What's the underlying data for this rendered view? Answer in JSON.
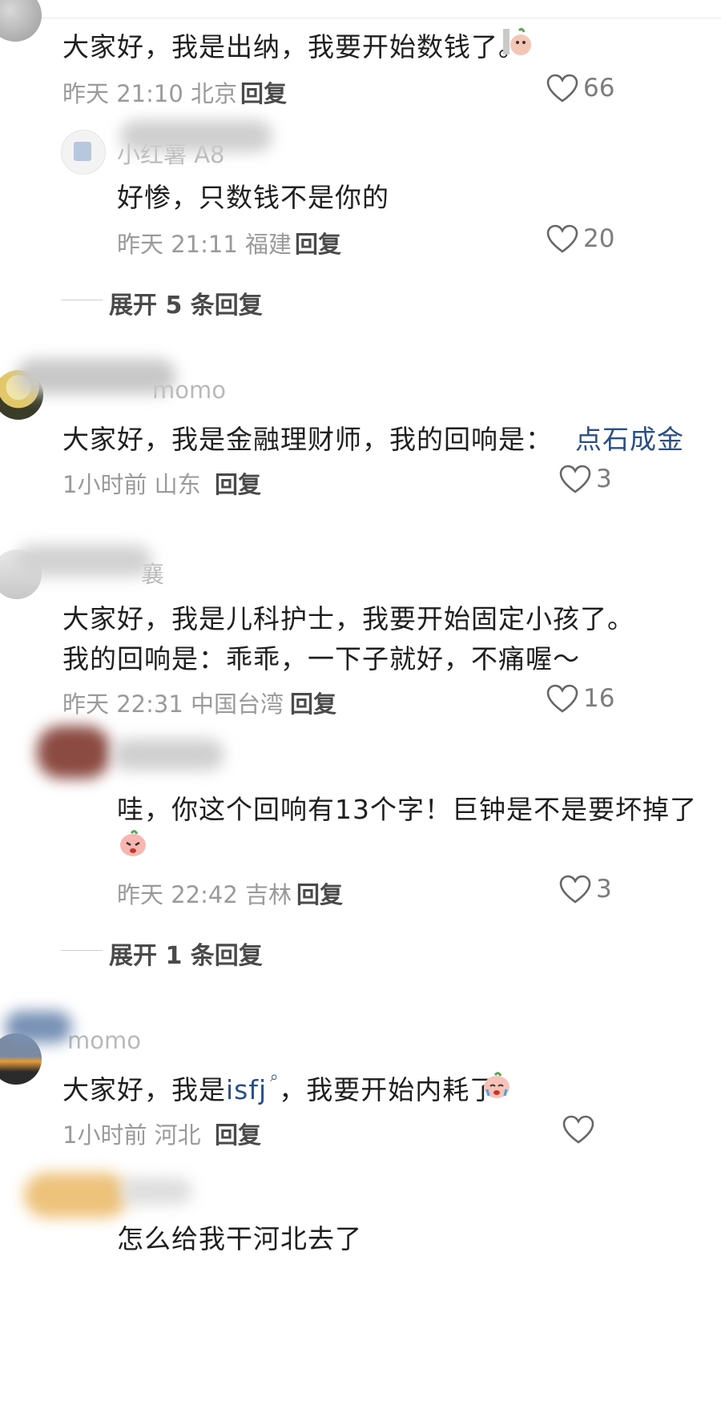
{
  "comments": [
    {
      "text": "大家好，我是出纳，我要开始数钱了。",
      "time": "昨天 21:10",
      "location": "北京",
      "reply_label": "回复",
      "likes": "66",
      "replies": [
        {
          "username": "小红薯 A8",
          "text": "好惨，只数钱不是你的",
          "time": "昨天 21:11",
          "location": "福建",
          "reply_label": "回复",
          "likes": "20"
        }
      ],
      "expand_label": "展开 5 条回复"
    },
    {
      "username": "momo",
      "text_prefix": "大家好，我是金融理财师，我的回响是：",
      "text_link": "点石成金",
      "time": "1小时前",
      "location": "山东",
      "reply_label": "回复",
      "likes": "3"
    },
    {
      "username": "襄",
      "text_line1": "大家好，我是儿科护士，我要开始固定小孩了。",
      "text_line2": "我的回响是：乖乖，一下子就好，不痛喔～",
      "time": "昨天 22:31",
      "location": "中国台湾",
      "reply_label": "回复",
      "likes": "16",
      "replies": [
        {
          "text": "哇，你这个回响有13个字！巨钟是不是要坏掉了",
          "time": "昨天 22:42",
          "location": "吉林",
          "reply_label": "回复",
          "likes": "3"
        }
      ],
      "expand_label": "展开 1 条回复"
    },
    {
      "username": "momo",
      "text_prefix": "大家好，我是",
      "text_link": "isfj",
      "text_suffix": "，我要开始内耗了",
      "time": "1小时前",
      "location": "河北",
      "reply_label": "回复",
      "likes": "",
      "replies": [
        {
          "text": "怎么给我干河北去了"
        }
      ]
    }
  ],
  "icons": {
    "heart": "heart-outline-icon",
    "search": "search-icon"
  },
  "colors": {
    "link": "#2a4f86",
    "meta": "#9a9a9a",
    "text": "#1f1f1f"
  }
}
